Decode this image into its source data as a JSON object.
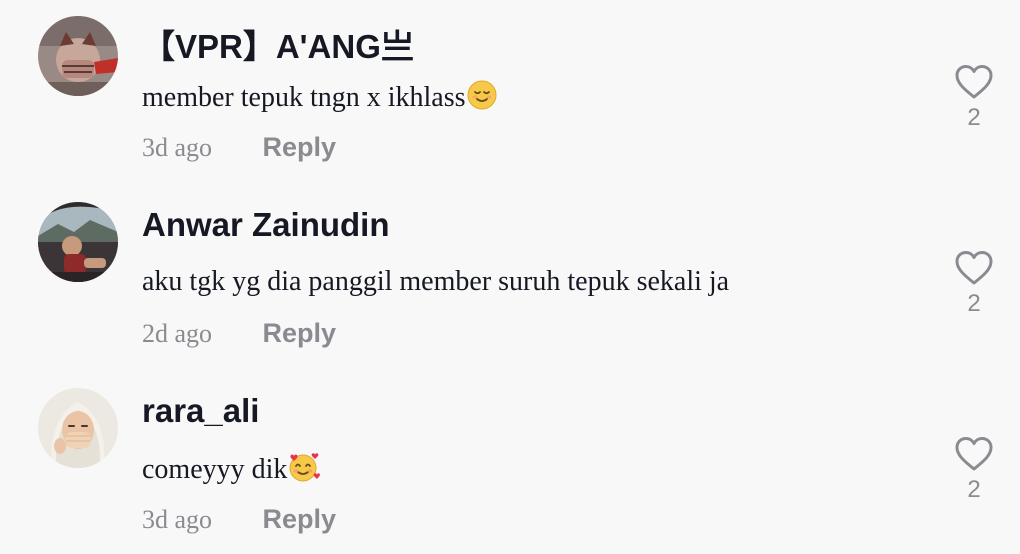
{
  "comments": [
    {
      "username": "【VPR】A'ANG亗",
      "text": "member tepuk tngn x ikhlass",
      "emoji": "relieved-face-emoji",
      "time": "3d ago",
      "reply_label": "Reply",
      "likes": "2",
      "avatar": "masked-person-avatar"
    },
    {
      "username": "Anwar Zainudin",
      "text": "aku tgk yg dia panggil member suruh tepuk sekali ja",
      "time": "2d ago",
      "reply_label": "Reply",
      "likes": "2",
      "avatar": "person-in-car-avatar"
    },
    {
      "username": "rara_ali",
      "text": "comeyyy dik",
      "emoji": "smiling-face-with-hearts-emoji",
      "time": "3d ago",
      "reply_label": "Reply",
      "likes": "2",
      "avatar": "hijab-woman-avatar"
    }
  ],
  "colors": {
    "background": "#f8f8f8",
    "primary_text": "#161823",
    "secondary_text": "#8a8b91",
    "heart_outline": "#8a8b91"
  }
}
